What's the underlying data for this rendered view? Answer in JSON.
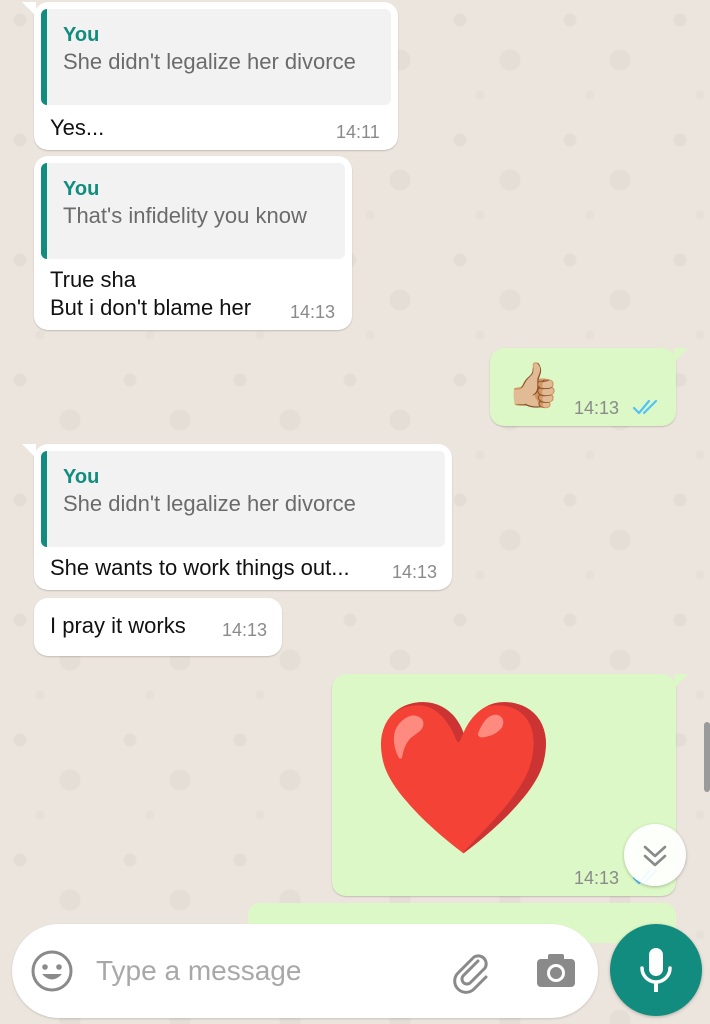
{
  "messages": [
    {
      "direction": "incoming",
      "quote": {
        "author": "You",
        "text": "She didn't legalize her divorce"
      },
      "lines": [
        "Yes..."
      ],
      "time": "14:11"
    },
    {
      "direction": "incoming",
      "quote": {
        "author": "You",
        "text": "That's infidelity you know"
      },
      "lines": [
        "True sha",
        "But i don't blame her"
      ],
      "time": "14:13"
    },
    {
      "direction": "outgoing",
      "emoji": "👍🏼",
      "time": "14:13",
      "status": "read"
    },
    {
      "direction": "incoming",
      "quote": {
        "author": "You",
        "text": "She didn't legalize her divorce"
      },
      "lines": [
        "She wants to work things out..."
      ],
      "time": "14:13"
    },
    {
      "direction": "incoming",
      "lines": [
        "I pray it works"
      ],
      "time": "14:13"
    },
    {
      "direction": "outgoing",
      "emoji": "❤️",
      "time": "14:13",
      "status": "read"
    }
  ],
  "composer": {
    "placeholder": "Type a message"
  },
  "colors": {
    "wallpaper": "#ece5dd",
    "incoming_bubble": "#ffffff",
    "outgoing_bubble": "#dcf8c6",
    "accent": "#128c7e",
    "read_ticks": "#4fc3f7"
  },
  "icons": {
    "composer": [
      "emoji-icon",
      "attach-icon",
      "camera-icon",
      "mic-icon"
    ],
    "scroll": "double-chevron-down-icon",
    "status": "double-check-icon"
  }
}
